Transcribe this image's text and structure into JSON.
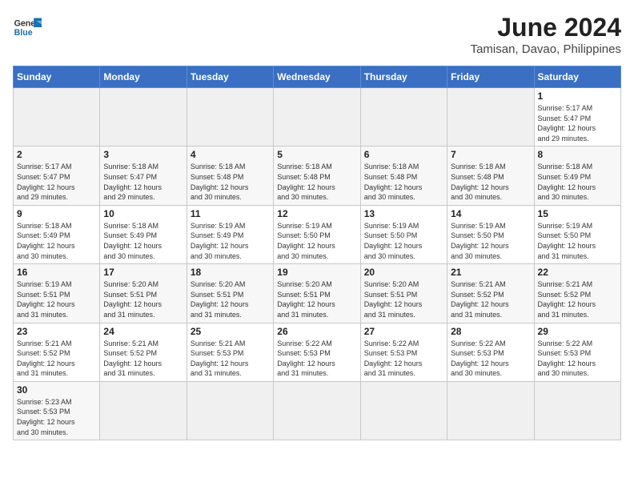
{
  "logo": {
    "line1": "General",
    "line2": "Blue"
  },
  "title": "June 2024",
  "subtitle": "Tamisan, Davao, Philippines",
  "headers": [
    "Sunday",
    "Monday",
    "Tuesday",
    "Wednesday",
    "Thursday",
    "Friday",
    "Saturday"
  ],
  "weeks": [
    [
      {
        "day": "",
        "info": "",
        "empty": true
      },
      {
        "day": "",
        "info": "",
        "empty": true
      },
      {
        "day": "",
        "info": "",
        "empty": true
      },
      {
        "day": "",
        "info": "",
        "empty": true
      },
      {
        "day": "",
        "info": "",
        "empty": true
      },
      {
        "day": "",
        "info": "",
        "empty": true
      },
      {
        "day": "1",
        "info": "Sunrise: 5:17 AM\nSunset: 5:47 PM\nDaylight: 12 hours\nand 29 minutes.",
        "empty": false
      }
    ],
    [
      {
        "day": "2",
        "info": "Sunrise: 5:17 AM\nSunset: 5:47 PM\nDaylight: 12 hours\nand 29 minutes.",
        "empty": false
      },
      {
        "day": "3",
        "info": "Sunrise: 5:18 AM\nSunset: 5:47 PM\nDaylight: 12 hours\nand 29 minutes.",
        "empty": false
      },
      {
        "day": "4",
        "info": "Sunrise: 5:18 AM\nSunset: 5:48 PM\nDaylight: 12 hours\nand 30 minutes.",
        "empty": false
      },
      {
        "day": "5",
        "info": "Sunrise: 5:18 AM\nSunset: 5:48 PM\nDaylight: 12 hours\nand 30 minutes.",
        "empty": false
      },
      {
        "day": "6",
        "info": "Sunrise: 5:18 AM\nSunset: 5:48 PM\nDaylight: 12 hours\nand 30 minutes.",
        "empty": false
      },
      {
        "day": "7",
        "info": "Sunrise: 5:18 AM\nSunset: 5:48 PM\nDaylight: 12 hours\nand 30 minutes.",
        "empty": false
      },
      {
        "day": "8",
        "info": "Sunrise: 5:18 AM\nSunset: 5:49 PM\nDaylight: 12 hours\nand 30 minutes.",
        "empty": false
      }
    ],
    [
      {
        "day": "9",
        "info": "Sunrise: 5:18 AM\nSunset: 5:49 PM\nDaylight: 12 hours\nand 30 minutes.",
        "empty": false
      },
      {
        "day": "10",
        "info": "Sunrise: 5:18 AM\nSunset: 5:49 PM\nDaylight: 12 hours\nand 30 minutes.",
        "empty": false
      },
      {
        "day": "11",
        "info": "Sunrise: 5:19 AM\nSunset: 5:49 PM\nDaylight: 12 hours\nand 30 minutes.",
        "empty": false
      },
      {
        "day": "12",
        "info": "Sunrise: 5:19 AM\nSunset: 5:50 PM\nDaylight: 12 hours\nand 30 minutes.",
        "empty": false
      },
      {
        "day": "13",
        "info": "Sunrise: 5:19 AM\nSunset: 5:50 PM\nDaylight: 12 hours\nand 30 minutes.",
        "empty": false
      },
      {
        "day": "14",
        "info": "Sunrise: 5:19 AM\nSunset: 5:50 PM\nDaylight: 12 hours\nand 30 minutes.",
        "empty": false
      },
      {
        "day": "15",
        "info": "Sunrise: 5:19 AM\nSunset: 5:50 PM\nDaylight: 12 hours\nand 31 minutes.",
        "empty": false
      }
    ],
    [
      {
        "day": "16",
        "info": "Sunrise: 5:19 AM\nSunset: 5:51 PM\nDaylight: 12 hours\nand 31 minutes.",
        "empty": false
      },
      {
        "day": "17",
        "info": "Sunrise: 5:20 AM\nSunset: 5:51 PM\nDaylight: 12 hours\nand 31 minutes.",
        "empty": false
      },
      {
        "day": "18",
        "info": "Sunrise: 5:20 AM\nSunset: 5:51 PM\nDaylight: 12 hours\nand 31 minutes.",
        "empty": false
      },
      {
        "day": "19",
        "info": "Sunrise: 5:20 AM\nSunset: 5:51 PM\nDaylight: 12 hours\nand 31 minutes.",
        "empty": false
      },
      {
        "day": "20",
        "info": "Sunrise: 5:20 AM\nSunset: 5:51 PM\nDaylight: 12 hours\nand 31 minutes.",
        "empty": false
      },
      {
        "day": "21",
        "info": "Sunrise: 5:21 AM\nSunset: 5:52 PM\nDaylight: 12 hours\nand 31 minutes.",
        "empty": false
      },
      {
        "day": "22",
        "info": "Sunrise: 5:21 AM\nSunset: 5:52 PM\nDaylight: 12 hours\nand 31 minutes.",
        "empty": false
      }
    ],
    [
      {
        "day": "23",
        "info": "Sunrise: 5:21 AM\nSunset: 5:52 PM\nDaylight: 12 hours\nand 31 minutes.",
        "empty": false
      },
      {
        "day": "24",
        "info": "Sunrise: 5:21 AM\nSunset: 5:52 PM\nDaylight: 12 hours\nand 31 minutes.",
        "empty": false
      },
      {
        "day": "25",
        "info": "Sunrise: 5:21 AM\nSunset: 5:53 PM\nDaylight: 12 hours\nand 31 minutes.",
        "empty": false
      },
      {
        "day": "26",
        "info": "Sunrise: 5:22 AM\nSunset: 5:53 PM\nDaylight: 12 hours\nand 31 minutes.",
        "empty": false
      },
      {
        "day": "27",
        "info": "Sunrise: 5:22 AM\nSunset: 5:53 PM\nDaylight: 12 hours\nand 31 minutes.",
        "empty": false
      },
      {
        "day": "28",
        "info": "Sunrise: 5:22 AM\nSunset: 5:53 PM\nDaylight: 12 hours\nand 30 minutes.",
        "empty": false
      },
      {
        "day": "29",
        "info": "Sunrise: 5:22 AM\nSunset: 5:53 PM\nDaylight: 12 hours\nand 30 minutes.",
        "empty": false
      }
    ],
    [
      {
        "day": "30",
        "info": "Sunrise: 5:23 AM\nSunset: 5:53 PM\nDaylight: 12 hours\nand 30 minutes.",
        "empty": false
      },
      {
        "day": "",
        "info": "",
        "empty": true
      },
      {
        "day": "",
        "info": "",
        "empty": true
      },
      {
        "day": "",
        "info": "",
        "empty": true
      },
      {
        "day": "",
        "info": "",
        "empty": true
      },
      {
        "day": "",
        "info": "",
        "empty": true
      },
      {
        "day": "",
        "info": "",
        "empty": true
      }
    ]
  ]
}
